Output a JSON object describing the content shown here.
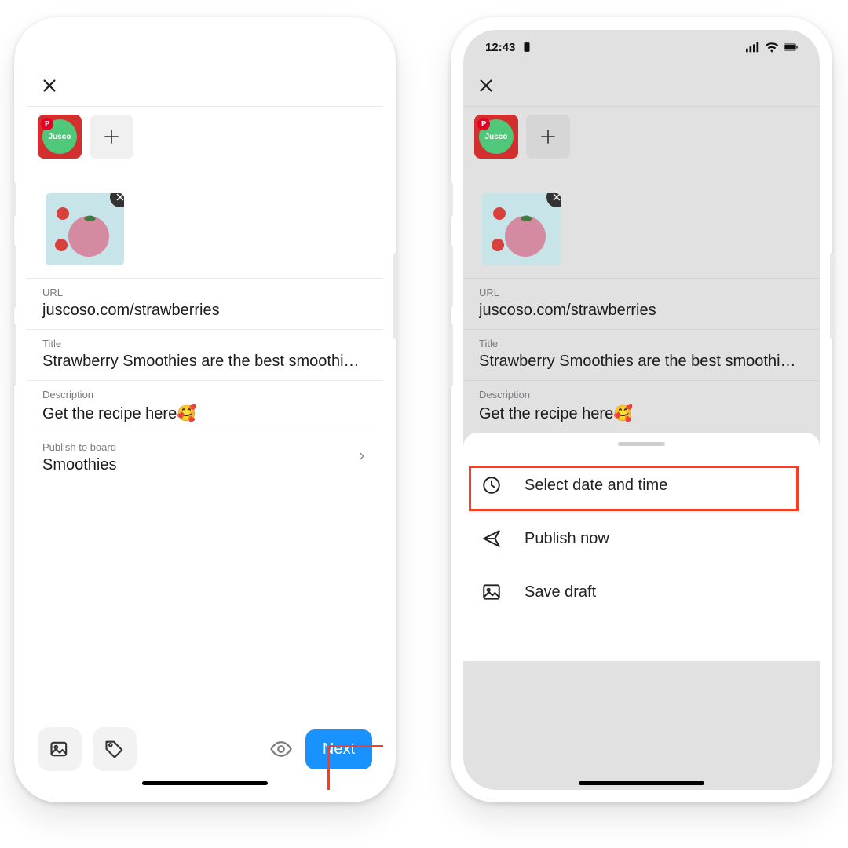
{
  "status": {
    "time": "12:43"
  },
  "account": {
    "brand_label": "Jusco",
    "pinterest_badge": "P"
  },
  "fields": {
    "url_label": "URL",
    "url_value": "juscoso.com/strawberries",
    "title_label": "Title",
    "title_value": "Strawberry Smoothies are the best smoothies…",
    "desc_label": "Description",
    "desc_value": "Get the recipe here🥰",
    "board_label": "Publish to board",
    "board_value": "Smoothies"
  },
  "footer": {
    "next": "Next"
  },
  "sheet": {
    "schedule": "Select date and time",
    "publish": "Publish now",
    "draft": "Save draft"
  }
}
